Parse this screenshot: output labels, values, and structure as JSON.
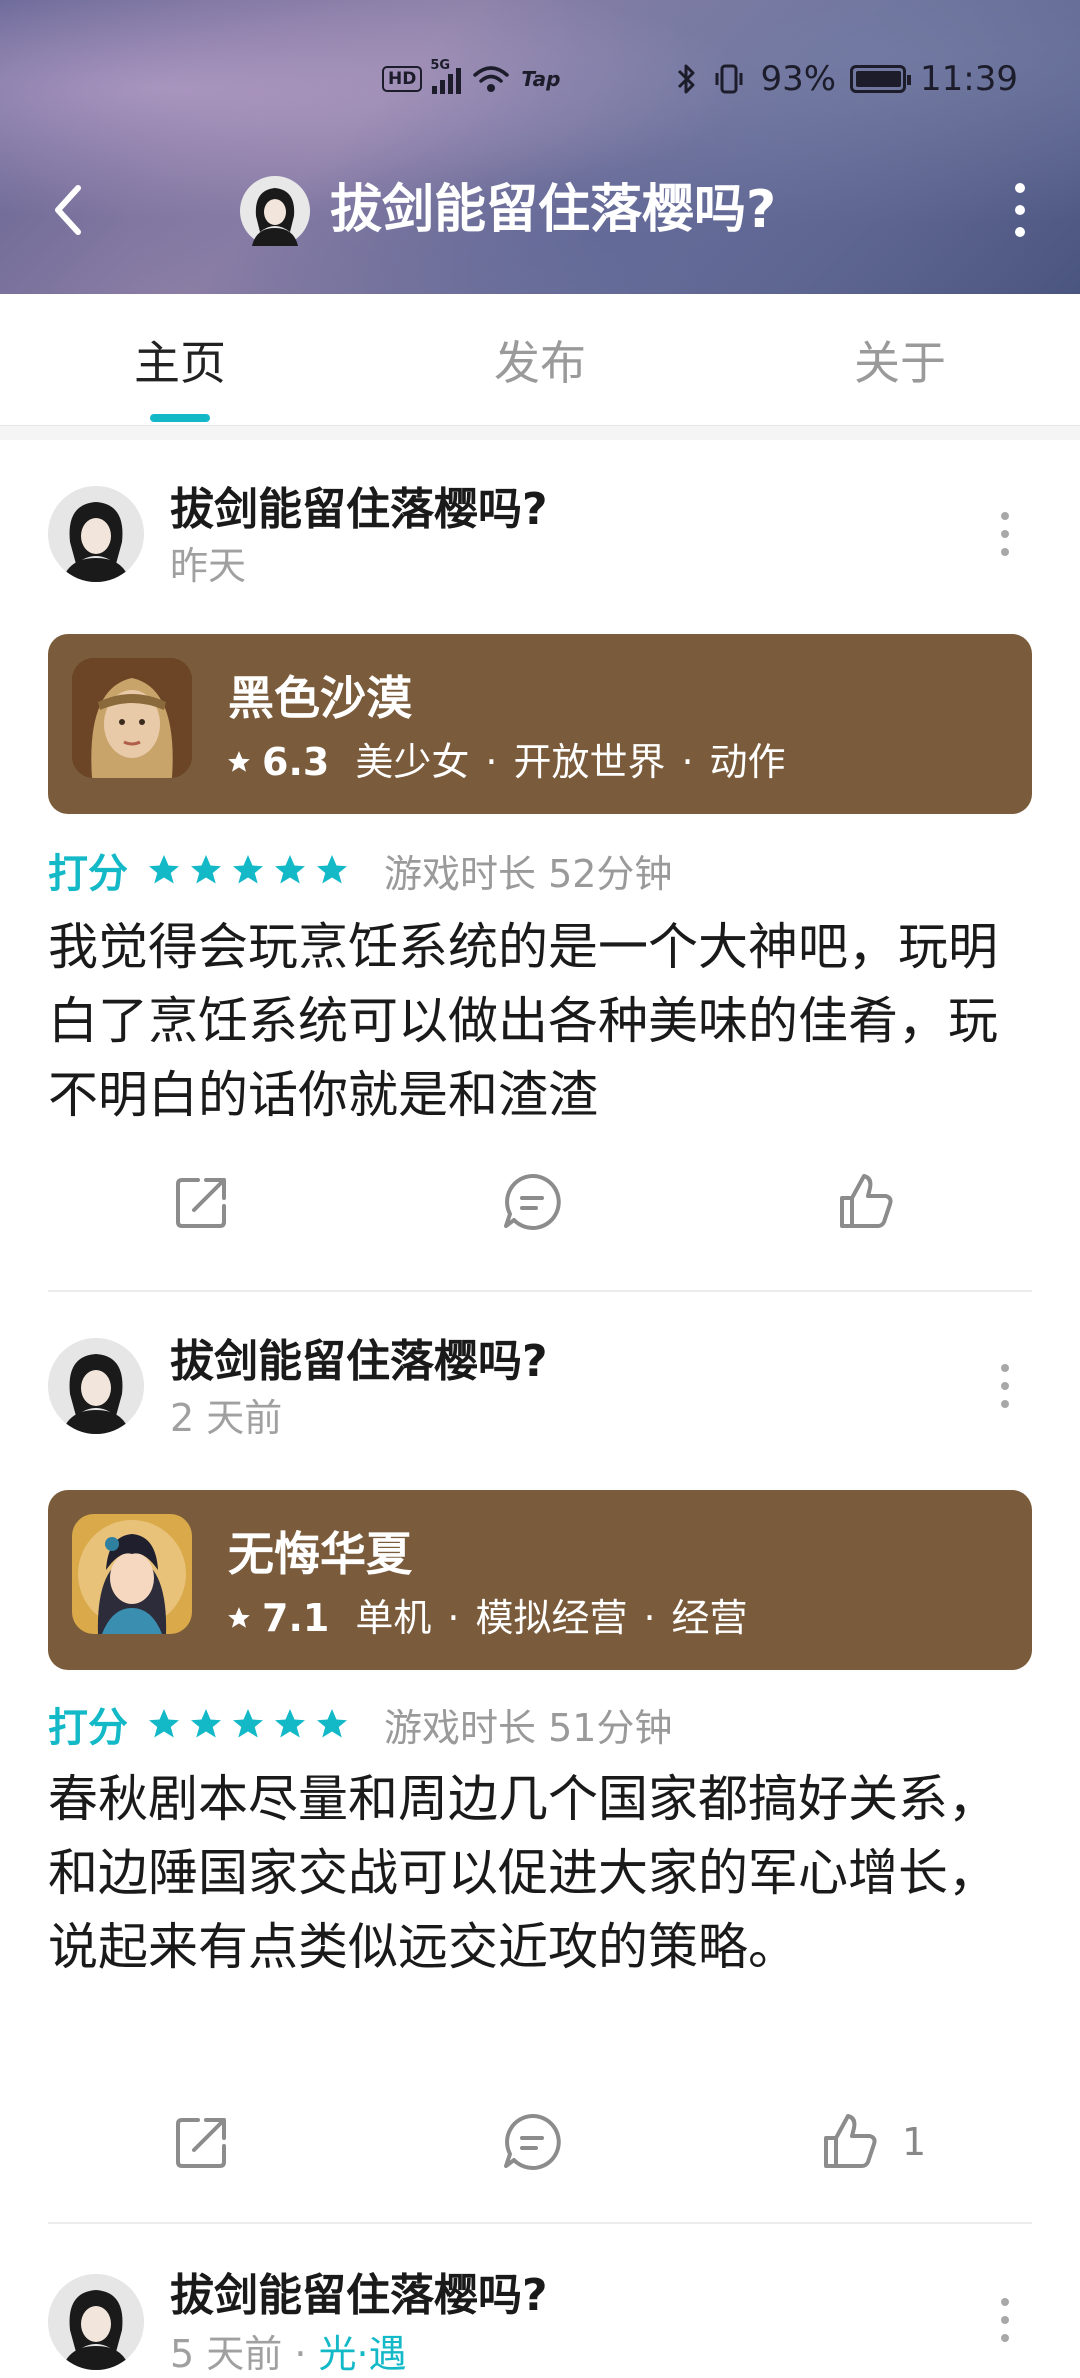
{
  "status_bar": {
    "hd": "HD",
    "network": "5G",
    "tap": "Tap",
    "battery": "93%",
    "time": "11:39"
  },
  "header": {
    "title": "拔剑能留住落樱吗?"
  },
  "tabs": [
    {
      "label": "主页",
      "active": true
    },
    {
      "label": "发布",
      "active": false
    },
    {
      "label": "关于",
      "active": false
    }
  ],
  "posts": [
    {
      "author": "拔剑能留住落樱吗?",
      "time": "昨天",
      "game": {
        "name": "黑色沙漠",
        "score": "6.3",
        "tags": [
          "美少女",
          "开放世界",
          "动作"
        ],
        "card_color": "#7a5b3b"
      },
      "rating_label": "打分",
      "stars": 5,
      "playtime": "游戏时长 52分钟",
      "body": "我觉得会玩烹饪系统的是一个大神吧，玩明白了烹饪系统可以做出各种美味的佳肴，玩不明白的话你就是和渣渣",
      "likes": ""
    },
    {
      "author": "拔剑能留住落樱吗?",
      "time": "2 天前",
      "game": {
        "name": "无悔华夏",
        "score": "7.1",
        "tags": [
          "单机",
          "模拟经营",
          "经营"
        ],
        "card_color": "#7a5b3b"
      },
      "rating_label": "打分",
      "stars": 5,
      "playtime": "游戏时长 51分钟",
      "body": "春秋剧本尽量和周边几个国家都搞好关系，和边陲国家交战可以促进大家的军心增长，说起来有点类似远交近攻的策略。",
      "likes": "1"
    },
    {
      "author": "拔剑能留住落樱吗?",
      "time": "5 天前",
      "tag": "光·遇"
    }
  ],
  "colors": {
    "accent": "#14b9c8",
    "card": "#7a5b3b"
  },
  "icons": {
    "back": "chevron-left-icon",
    "more": "more-vertical-icon",
    "share": "share-icon",
    "comment": "comment-icon",
    "like": "thumbs-up-icon",
    "star": "star-icon"
  }
}
